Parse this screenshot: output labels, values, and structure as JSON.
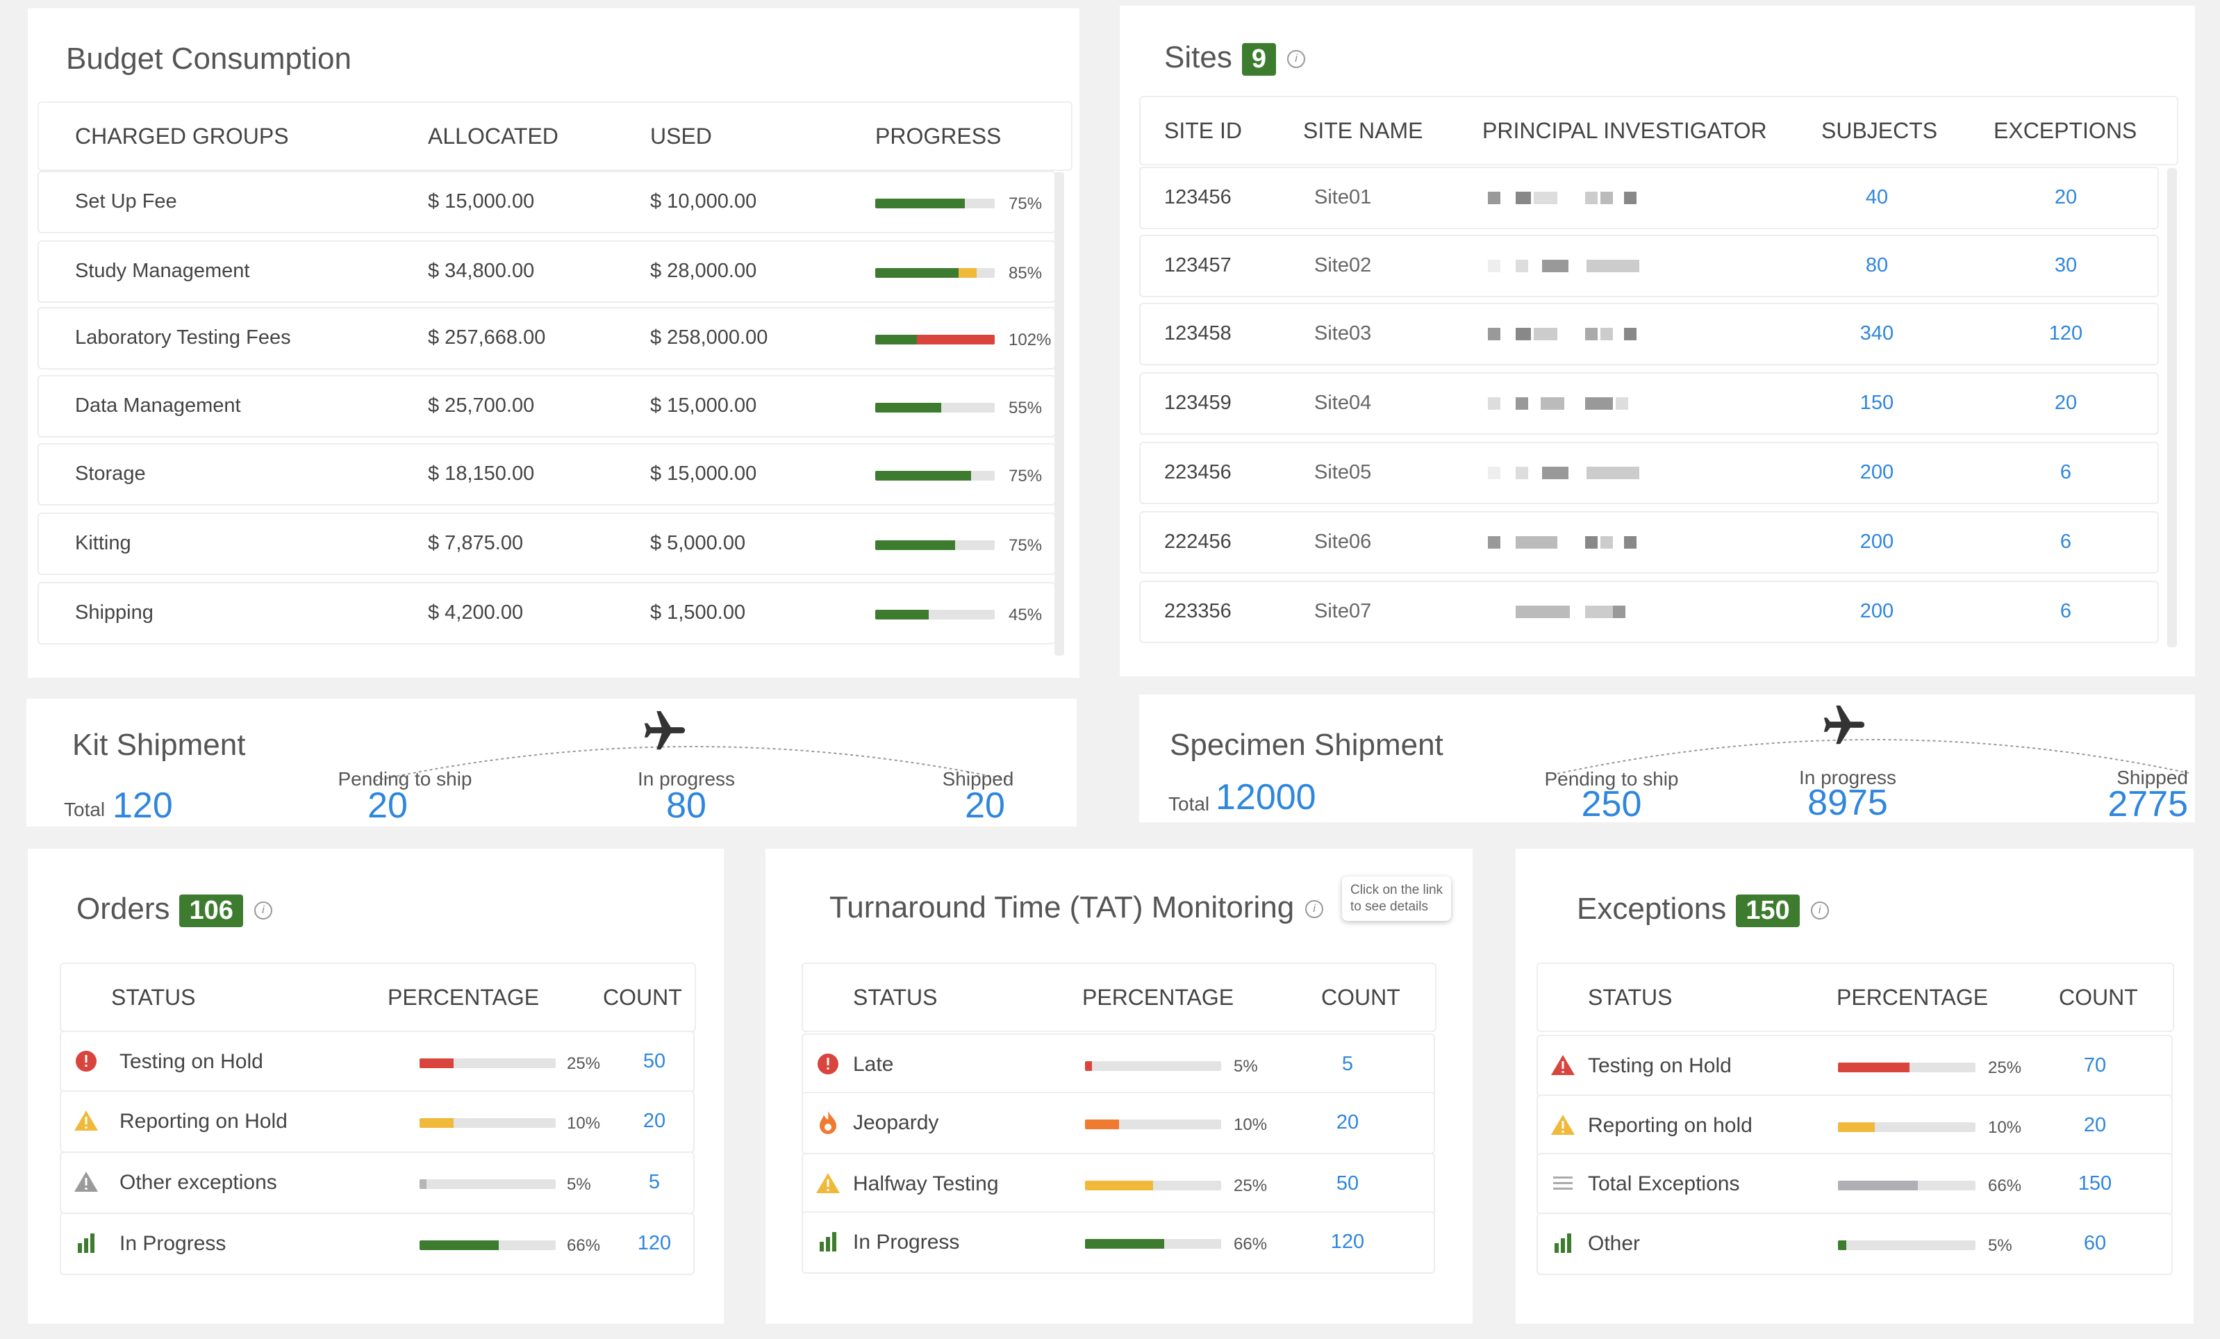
{
  "budget": {
    "title": "Budget Consumption",
    "headers": [
      "CHARGED GROUPS",
      "ALLOCATED",
      "USED",
      "PROGRESS"
    ],
    "rows": [
      {
        "group": "Set Up Fee",
        "allocated": "$  15,000.00",
        "used": "$  10,000.00",
        "pct": "75%",
        "green": 75,
        "overflow": 0,
        "yellow": 0
      },
      {
        "group": "Study Management",
        "allocated": "$  34,800.00",
        "used": "$  28,000.00",
        "pct": "85%",
        "green": 70,
        "overflow": 0,
        "yellow": 15
      },
      {
        "group": "Laboratory Testing Fees",
        "allocated": "$  257,668.00",
        "used": "$  258,000.00",
        "pct": "102%",
        "green": 35,
        "overflow": 67,
        "yellow": 0
      },
      {
        "group": "Data Management",
        "allocated": "$  25,700.00",
        "used": "$  15,000.00",
        "pct": "55%",
        "green": 55,
        "overflow": 0,
        "yellow": 0
      },
      {
        "group": "Storage",
        "allocated": "$  18,150.00",
        "used": "$  15,000.00",
        "pct": "75%",
        "green": 80,
        "overflow": 0,
        "yellow": 0
      },
      {
        "group": "Kitting",
        "allocated": "$  7,875.00",
        "used": "$  5,000.00",
        "pct": "75%",
        "green": 67,
        "overflow": 0,
        "yellow": 0
      },
      {
        "group": "Shipping",
        "allocated": "$  4,200.00",
        "used": "$  1,500.00",
        "pct": "45%",
        "green": 45,
        "overflow": 0,
        "yellow": 0
      }
    ]
  },
  "sites": {
    "title": "Sites",
    "count": "9",
    "headers": [
      "SITE ID",
      "SITE NAME",
      "PRINCIPAL INVESTIGATOR",
      "SUBJECTS",
      "EXCEPTIONS"
    ],
    "rows": [
      {
        "id": "123456",
        "name": "Site01",
        "subjects": "40",
        "exceptions": "20"
      },
      {
        "id": "123457",
        "name": "Site02",
        "subjects": "80",
        "exceptions": "30"
      },
      {
        "id": "123458",
        "name": "Site03",
        "subjects": "340",
        "exceptions": "120"
      },
      {
        "id": "123459",
        "name": "Site04",
        "subjects": "150",
        "exceptions": "20"
      },
      {
        "id": "223456",
        "name": "Site05",
        "subjects": "200",
        "exceptions": "6"
      },
      {
        "id": "222456",
        "name": "Site06",
        "subjects": "200",
        "exceptions": "6"
      },
      {
        "id": "223356",
        "name": "Site07",
        "subjects": "200",
        "exceptions": "6"
      }
    ]
  },
  "kit": {
    "title": "Kit Shipment",
    "total_label": "Total",
    "total": "120",
    "pending_label": "Pending to ship",
    "pending": "20",
    "progress_label": "In progress",
    "progress": "80",
    "shipped_label": "Shipped",
    "shipped": "20"
  },
  "specimen": {
    "title": "Specimen Shipment",
    "total_label": "Total",
    "total": "12000",
    "pending_label": "Pending to ship",
    "pending": "250",
    "progress_label": "In progress",
    "progress": "8975",
    "shipped_label": "Shipped",
    "shipped": "2775"
  },
  "orders": {
    "title": "Orders",
    "count": "106",
    "headers": [
      "STATUS",
      "PERCENTAGE",
      "COUNT"
    ],
    "rows": [
      {
        "icon": "error-icon",
        "status": "Testing on Hold",
        "pct": "25%",
        "value": 25,
        "color": "#d9453c",
        "count": "50"
      },
      {
        "icon": "warning-icon",
        "status": "Reporting on Hold",
        "pct": "10%",
        "value": 25,
        "color": "#f0b93a",
        "count": "20"
      },
      {
        "icon": "gray-warning-icon",
        "status": "Other exceptions",
        "pct": "5%",
        "value": 5,
        "color": "#b5b5b5",
        "count": "5"
      },
      {
        "icon": "bar-chart-icon",
        "status": "In Progress",
        "pct": "66%",
        "value": 58,
        "color": "#3d7c2f",
        "count": "120"
      }
    ]
  },
  "tat": {
    "title": "Turnaround Time (TAT) Monitoring",
    "tooltip_line1": "Click on the link",
    "tooltip_line2": "to see details",
    "headers": [
      "STATUS",
      "PERCENTAGE",
      "COUNT"
    ],
    "rows": [
      {
        "icon": "error-icon",
        "status": "Late",
        "pct": "5%",
        "value": 5,
        "color": "#d9453c",
        "count": "5"
      },
      {
        "icon": "fire-icon",
        "status": "Jeopardy",
        "pct": "10%",
        "value": 25,
        "color": "#ef7a30",
        "count": "20"
      },
      {
        "icon": "warning-icon",
        "status": "Halfway Testing",
        "pct": "25%",
        "value": 50,
        "color": "#f0b93a",
        "count": "50"
      },
      {
        "icon": "bar-chart-icon",
        "status": "In Progress",
        "pct": "66%",
        "value": 58,
        "color": "#3d7c2f",
        "count": "120"
      }
    ]
  },
  "exceptions": {
    "title": "Exceptions",
    "count": "150",
    "headers": [
      "STATUS",
      "PERCENTAGE",
      "COUNT"
    ],
    "rows": [
      {
        "icon": "error-triangle-icon",
        "status": "Testing on Hold",
        "pct": "25%",
        "value": 52,
        "color": "#d9453c",
        "count": "70"
      },
      {
        "icon": "warning-icon",
        "status": "Reporting on hold",
        "pct": "10%",
        "value": 27,
        "color": "#f0b93a",
        "count": "20"
      },
      {
        "icon": "list-icon",
        "status": "Total Exceptions",
        "pct": "66%",
        "value": 58,
        "color": "#b0b0b4",
        "count": "150"
      },
      {
        "icon": "bar-chart-icon",
        "status": "Other",
        "pct": "5%",
        "value": 6,
        "color": "#3d7c2f",
        "count": "60"
      }
    ]
  }
}
